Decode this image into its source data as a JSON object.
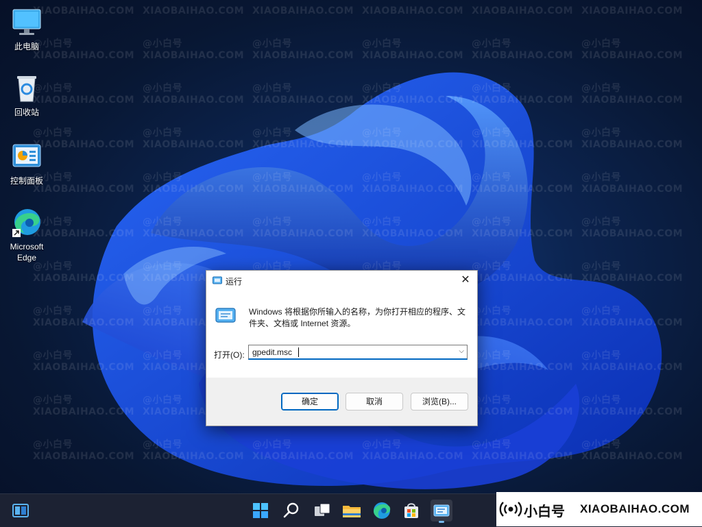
{
  "desktop": {
    "icons": [
      {
        "label": "此电脑",
        "icon": "computer-icon"
      },
      {
        "label": "回收站",
        "icon": "recycle-bin-icon"
      },
      {
        "label": "控制面板",
        "icon": "control-panel-icon"
      },
      {
        "label": "Microsoft Edge",
        "icon": "edge-icon"
      }
    ],
    "watermark_text": "XIAOBAIHAO.COM",
    "watermark_handle": "@小白号"
  },
  "run_dialog": {
    "title": "运行",
    "description": "Windows 将根据你所输入的名称，为你打开相应的程序、文件夹、文档或 Internet 资源。",
    "open_label": "打开(O):",
    "input_value": "gpedit.msc",
    "ok_label": "确定",
    "cancel_label": "取消",
    "browse_label": "浏览(B)...",
    "close_glyph": "✕",
    "dropdown_glyph": "⌵"
  },
  "taskbar": {
    "items": [
      "start-icon",
      "search-icon",
      "task-view-icon",
      "file-explorer-icon",
      "edge-icon",
      "store-icon",
      "run-icon"
    ],
    "active_item": "run-icon"
  },
  "brand": {
    "name": "小白号",
    "url": "XIAOBAIHAO.COM"
  },
  "colors": {
    "accent": "#0067c0",
    "wallpaper_dark": "#0b1a33",
    "bloom_blue": "#1f4fe0"
  }
}
